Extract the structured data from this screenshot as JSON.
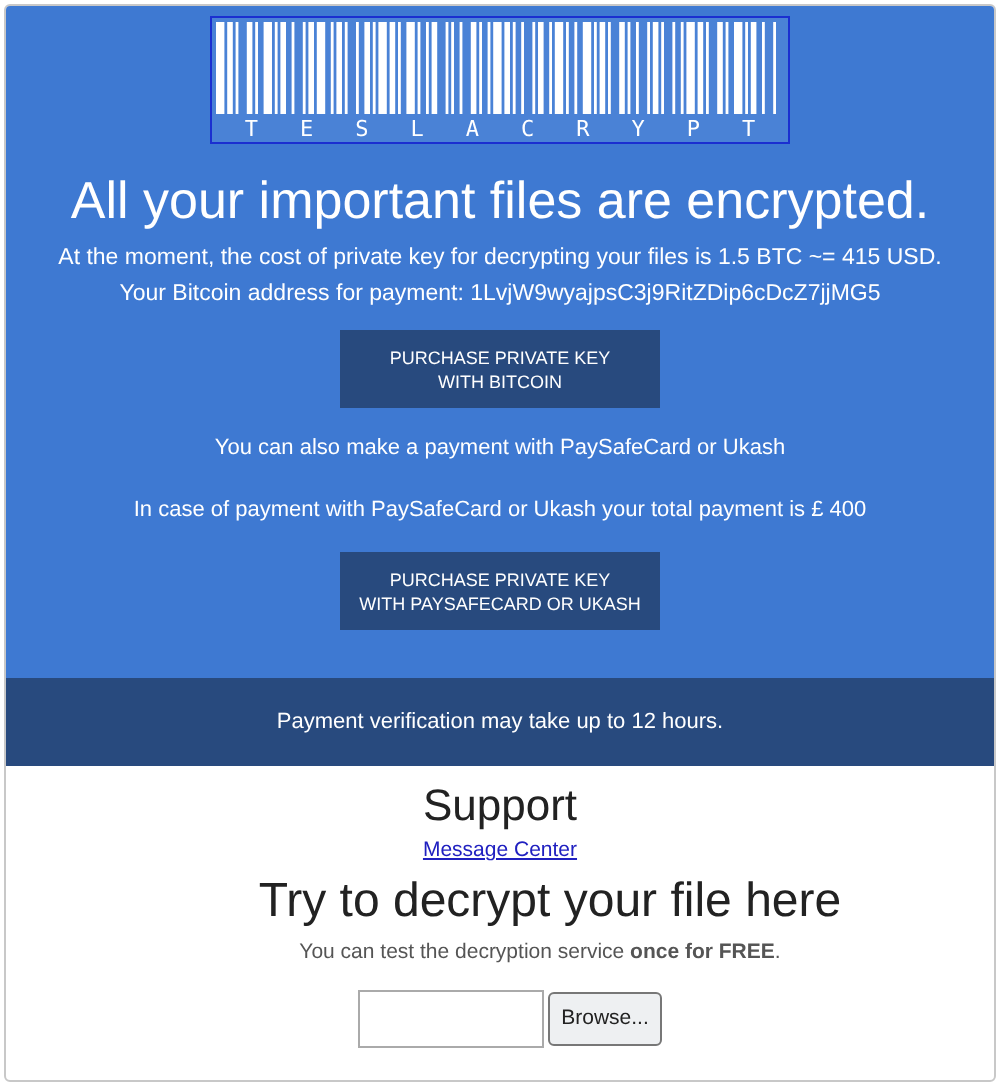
{
  "logo": {
    "text": "TESLACRYPT"
  },
  "headline": "All your important files are encrypted.",
  "cost_text": "At the moment, the cost of private key for decrypting your files is 1.5 BTC ~= 415 USD.",
  "address_text": "Your Bitcoin address for payment: 1LvjW9wyajpsC3j9RitZDip6cDcZ7jjMG5",
  "bitcoin_button": [
    "PURCHASE PRIVATE KEY",
    "WITH BITCOIN"
  ],
  "alt_payment_text": "You can also make a payment with PaySafeCard or Ukash",
  "alt_total_text": "In case of payment with PaySafeCard or Ukash your total payment is £ 400",
  "paysafe_button": [
    "PURCHASE PRIVATE KEY",
    "WITH PAYSAFECARD OR UKASH"
  ],
  "verification_note": "Payment verification may take up to 12 hours.",
  "support": {
    "title": "Support",
    "link": "Message Center"
  },
  "decrypt": {
    "title": "Try to decrypt your file here",
    "note": "You can test the decryption service **once for FREE**.",
    "browse_button": "Browse..."
  }
}
